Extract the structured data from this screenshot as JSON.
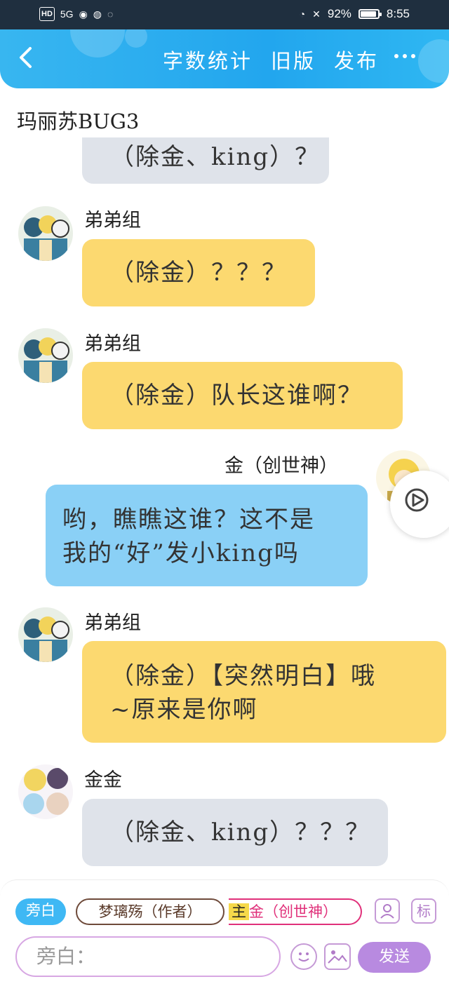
{
  "status_bar": {
    "network_badge": "HD",
    "network_type": "5G",
    "battery_percent": "92%",
    "battery_level": 0.92,
    "time": "8:55"
  },
  "header": {
    "actions": [
      "字数统计",
      "旧版",
      "发布"
    ]
  },
  "chat": {
    "title": "玛丽苏BUG3",
    "messages": [
      {
        "sender": "",
        "text": "（除金、king）？",
        "style": "gray",
        "partial": true
      },
      {
        "sender": "弟弟组",
        "text": "（除金）？？？",
        "style": "yellow"
      },
      {
        "sender": "弟弟组",
        "text": "（除金）队长这谁啊？",
        "style": "yellow"
      },
      {
        "sender": "金（创世神）",
        "text_line1": "哟，瞧瞧这谁？这不是",
        "text_line2": "我的“好”发小king吗",
        "style": "blue"
      },
      {
        "sender": "弟弟组",
        "text_line1": "（除金）【突然明白】哦",
        "text_line2": "~原来是你啊",
        "style": "yellow"
      },
      {
        "sender": "金金",
        "text": "（除金、king）？？？",
        "style": "gray"
      }
    ]
  },
  "composer": {
    "roles": [
      "旁白",
      "梦璃殇（作者）",
      "主",
      "金（创世神）"
    ],
    "profile_icon": "user-profile-icon",
    "tag_label": "标",
    "input_placeholder": "旁白：",
    "send_label": "发送"
  },
  "colors": {
    "header": "#22a6ee",
    "yellow_bubble": "#fcd970",
    "gray_bubble": "#dfe3ea",
    "blue_bubble": "#8ad0f6",
    "send_button": "#b88ae0"
  }
}
